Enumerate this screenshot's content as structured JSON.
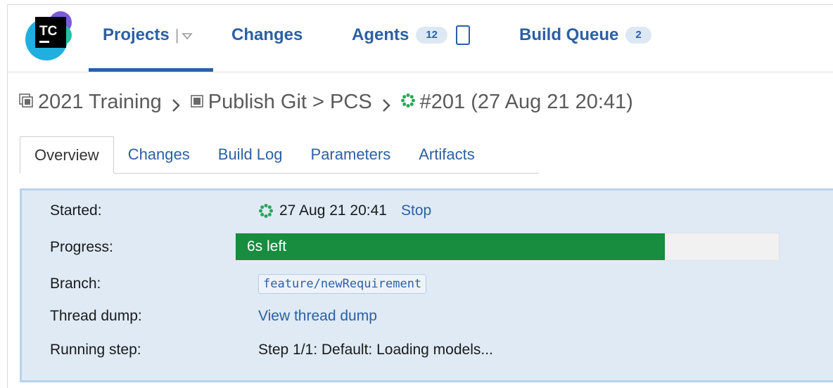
{
  "header": {
    "logo_text": "TC",
    "nav": {
      "projects_label": "Projects",
      "changes_label": "Changes",
      "agents_label": "Agents",
      "agents_count": "12",
      "build_queue_label": "Build Queue",
      "build_queue_count": "2"
    }
  },
  "breadcrumb": {
    "project": "2021 Training",
    "build_config": "Publish Git > PCS",
    "build": "#201 (27 Aug 21 20:41)"
  },
  "tabs": [
    "Overview",
    "Changes",
    "Build Log",
    "Parameters",
    "Artifacts"
  ],
  "details": {
    "started_label": "Started:",
    "started_value": "27 Aug 21 20:41",
    "stop_link": "Stop",
    "progress_label": "Progress:",
    "progress_text": "6s left",
    "progress_fraction": 0.79,
    "branch_label": "Branch:",
    "branch_value": "feature/newRequirement",
    "thread_dump_label": "Thread dump:",
    "thread_dump_link": "View thread dump",
    "running_step_label": "Running step:",
    "running_step_value": "Step 1/1: Default: Loading models..."
  },
  "icons": [
    "teamcity-logo-icon",
    "dropdown-chevron-icon",
    "agent-device-icon",
    "project-icon",
    "build-config-icon",
    "running-build-icon",
    "chevron-right-icon"
  ],
  "colors": {
    "link": "#2c5fa5",
    "progress_fill": "#188c3f",
    "panel_bg": "#dfeaf5",
    "running_icon": "#2aa55a"
  }
}
